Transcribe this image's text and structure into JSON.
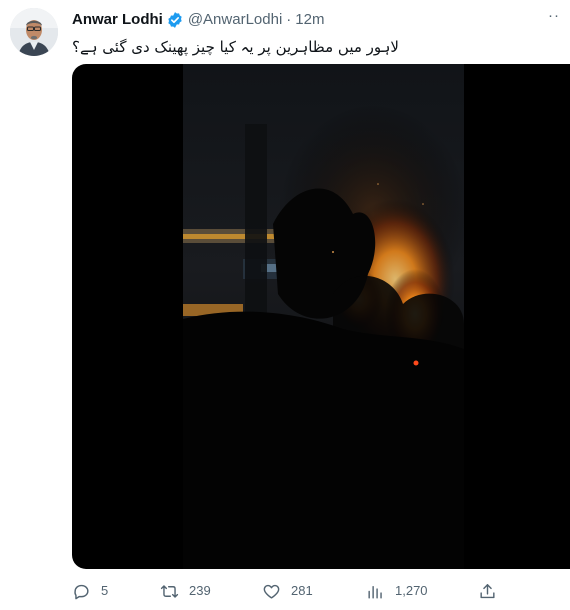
{
  "tweet": {
    "author": {
      "display_name": "Anwar Lodhi",
      "handle": "@AnwarLodhi",
      "verified": true
    },
    "separator": "·",
    "time": "12m",
    "text": "لاہور میں مظاہرین پر یہ کیا چیز پھینک دی گئی ہے؟",
    "more_icon": "more-options-icon",
    "more_glyph": "··",
    "media": {
      "type": "video",
      "description_icon": "video-player"
    },
    "actions": {
      "replies": "5",
      "retweets": "239",
      "likes": "281",
      "views": "1,270"
    }
  },
  "colors": {
    "text_primary": "#0f1419",
    "text_secondary": "#536471",
    "verified_badge": "#1d9bf0",
    "media_background": "#000000"
  }
}
